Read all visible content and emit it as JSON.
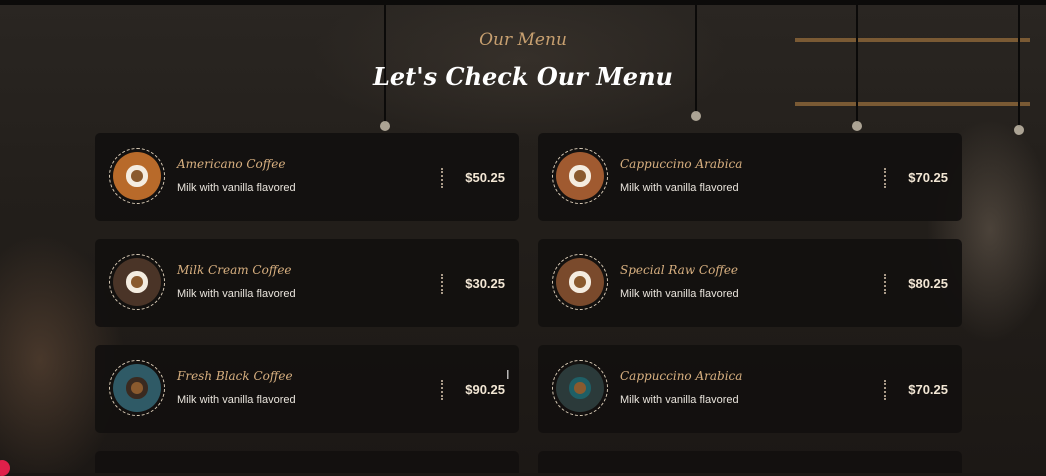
{
  "header": {
    "subtitle": "Our Menu",
    "title": "Let's Check Our Menu"
  },
  "menu": {
    "items": [
      {
        "name": "Americano Coffee",
        "desc": "Milk with vanilla flavored",
        "price": "$50.25",
        "icon": "latte-art-icon"
      },
      {
        "name": "Cappuccino Arabica",
        "desc": "Milk with vanilla flavored",
        "price": "$70.25",
        "icon": "coffee-cup-icon"
      },
      {
        "name": "Milk Cream Coffee",
        "desc": "Milk with vanilla flavored",
        "price": "$30.25",
        "icon": "cream-coffee-icon"
      },
      {
        "name": "Special Raw Coffee",
        "desc": "Milk with vanilla flavored",
        "price": "$80.25",
        "icon": "raw-coffee-icon"
      },
      {
        "name": "Fresh Black Coffee",
        "desc": "Milk with vanilla flavored",
        "price": "$90.25",
        "icon": "black-coffee-icon"
      },
      {
        "name": "Cappuccino Arabica",
        "desc": "Milk with vanilla flavored",
        "price": "$70.25",
        "icon": "cappuccino-icon"
      }
    ]
  },
  "colors": {
    "accent": "#d8b080",
    "card_bg": "#12100f",
    "title": "#ffffff"
  }
}
